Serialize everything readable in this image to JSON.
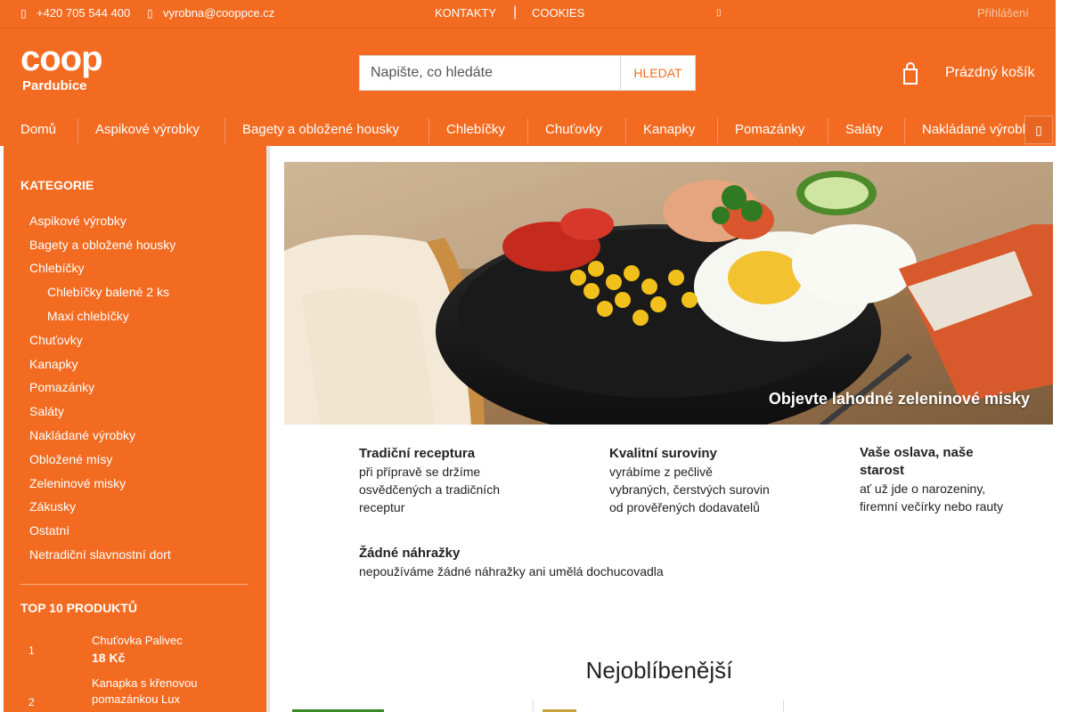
{
  "topbar": {
    "phone": "+420 705 544 400",
    "email": "vyrobna@cooppce.cz",
    "links": [
      "KONTAKTY",
      "COOKIES"
    ],
    "login": "Přihlášení"
  },
  "header": {
    "logo_brand": "coop",
    "logo_city": "Pardubice",
    "search_placeholder": "Napište, co hledáte",
    "search_button": "HLEDAT",
    "cart_label": "Prázdný košík"
  },
  "nav": {
    "items": [
      "Domů",
      "Aspikové výrobky",
      "Bagety a obložené housky",
      "Chlebíčky",
      "Chuťovky",
      "Kanapky",
      "Pomazánky",
      "Saláty",
      "Nakládané výrobky"
    ]
  },
  "sidebar": {
    "categories_heading": "KATEGORIE",
    "categories": [
      "Aspikové výrobky",
      "Bagety a obložené housky",
      "Chlebíčky",
      "Chlebíčky balené 2 ks",
      "Maxi chlebíčky",
      "Chuťovky",
      "Kanapky",
      "Pomazánky",
      "Saláty",
      "Nakládané výrobky",
      "Obložené mísy",
      "Zeleninové misky",
      "Zákusky",
      "Ostatní",
      "Netradiční slavnostní dort"
    ],
    "top_heading": "TOP 10 PRODUKTŮ",
    "top_products": [
      {
        "rank": "1",
        "name": "Chuťovka Palivec",
        "price": "18 Kč"
      },
      {
        "rank": "2",
        "name": "Kanapka s křenovou pomazánkou Lux"
      }
    ]
  },
  "banner": {
    "caption": "Objevte lahodné zeleninové misky"
  },
  "features": [
    {
      "title": "Tradiční receptura",
      "text": "při přípravě se držíme osvědčených a tradičních receptur"
    },
    {
      "title": "Kvalitní suroviny",
      "text": "vyrábíme z pečlivě vybraných, čerstvých surovin od prověřených dodavatelů"
    },
    {
      "title": "Vaše oslava, naše starost",
      "text": "ať už jde o narozeniny, firemní večírky nebo rauty"
    },
    {
      "title": "Žádné náhražky",
      "text": "nepoužíváme žádné náhražky ani umělá dochucovadla"
    }
  ],
  "featured": {
    "title": "Nejoblíbenější"
  },
  "colors": {
    "brand_orange": "#f26b21",
    "text": "#222222",
    "accent_light": "#f8b087"
  },
  "icons": {
    "phone": "phone-icon",
    "email": "envelope-icon",
    "cart": "cart-icon",
    "nav_more": "chevron-right-icon"
  }
}
